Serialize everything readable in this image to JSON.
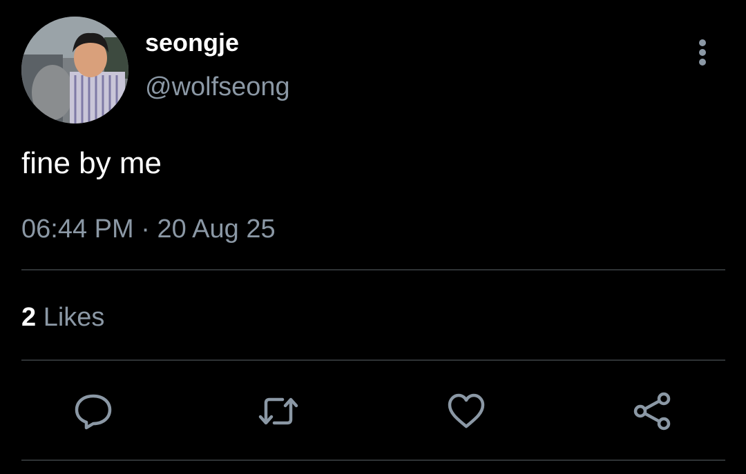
{
  "tweet": {
    "author": {
      "display_name": "seongje",
      "handle": "@wolfseong",
      "avatar_icon": "profile-photo"
    },
    "text": "fine by me",
    "time": "06:44 PM",
    "separator": "·",
    "date": "20 Aug 25",
    "likes": {
      "count": "2",
      "label": "Likes"
    },
    "actions": {
      "more_icon": "more-vertical-icon",
      "reply_icon": "reply-icon",
      "retweet_icon": "retweet-icon",
      "like_icon": "heart-icon",
      "share_icon": "share-icon"
    }
  },
  "colors": {
    "background": "#000000",
    "primary_text": "#ffffff",
    "secondary_text": "#8b98a5",
    "divider": "#2f3336",
    "icon": "#8b98a5"
  }
}
